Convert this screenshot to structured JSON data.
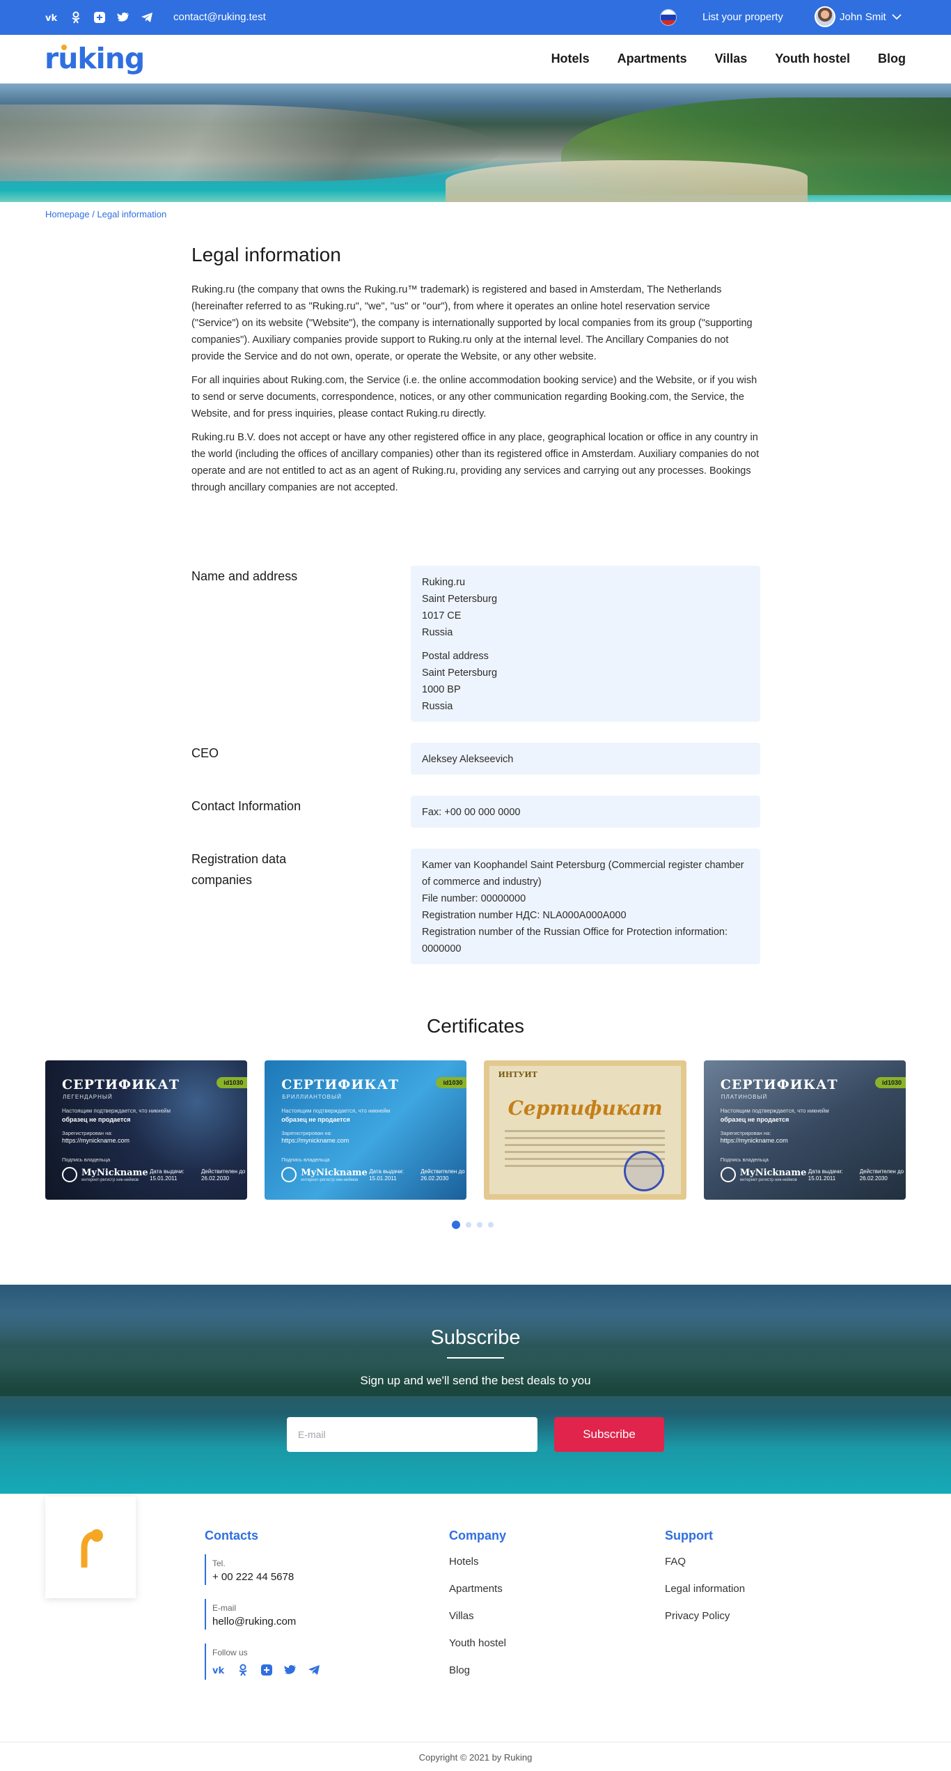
{
  "topbar": {
    "social_icons": [
      "vk-icon",
      "odnoklassniki-icon",
      "plus-icon",
      "twitter-icon",
      "telegram-icon"
    ],
    "email": "contact@ruking.test",
    "language_flag": "russia-flag",
    "list_property": "List your property",
    "user_name": "John Smit"
  },
  "header": {
    "logo_text": "ruking",
    "nav": [
      "Hotels",
      "Apartments",
      "Villas",
      "Youth hostel",
      "Blog"
    ]
  },
  "breadcrumb": {
    "home": "Homepage",
    "separator": " / ",
    "current": "Legal information"
  },
  "page": {
    "title": "Legal information",
    "paragraphs": [
      "Ruking.ru (the company that owns the Ruking.ru™ trademark) is registered and based in Amsterdam, The Netherlands (hereinafter referred to as \"Ruking.ru\", \"we\", \"us\" or \"our\"), from where it operates an online hotel reservation service (\"Service\") on its website (\"Website\"), the company is internationally supported by local companies from its group (\"supporting companies\"). Auxiliary companies provide support to Ruking.ru only at the internal level. The Ancillary Companies do not provide the Service and do not own, operate, or operate the Website, or any other website.",
      "For all inquiries about Ruking.com, the Service (i.e. the online accommodation booking service) and the Website, or if you wish to send or serve documents, correspondence, notices, or any other communication regarding Booking.com, the Service, the Website, and for press inquiries, please contact Ruking.ru directly.",
      "Ruking.ru B.V. does not accept or have any other registered office in any place, geographical location or office in any country in the world (including the offices of ancillary companies) other than its registered office in Amsterdam. Auxiliary companies do not operate and are not entitled to act as an agent of Ruking.ru, providing any services and carrying out any processes. Bookings through ancillary companies are not accepted."
    ]
  },
  "info": {
    "name_address": {
      "label": "Name and address",
      "lines_a": [
        "Ruking.ru",
        "Saint Petersburg",
        "1017 CE",
        "Russia"
      ],
      "lines_b": [
        "Postal address",
        "Saint Petersburg",
        "1000 BP",
        "Russia"
      ]
    },
    "ceo": {
      "label": "CEO",
      "value": "Aleksey Alekseevich"
    },
    "contact": {
      "label": "Contact Information",
      "value": "Fax: +00 00 000 0000"
    },
    "registration": {
      "label": "Registration data companies",
      "lines": [
        "Kamer van Koophandel  Saint Petersburg (Commercial register chamber of commerce and industry)",
        "File number: 00000000",
        "Registration number НДС: NLA000A000A000",
        "Registration number of the Russian Office for Protection information: 0000000"
      ]
    }
  },
  "certificates": {
    "title": "Certificates",
    "items": [
      {
        "title": "СЕРТИФИКАТ",
        "subtitle": "ЛЕГЕНДАРНЫЙ",
        "id": "id1030",
        "confirm": "Настоящим подтверждается, что никнейм",
        "not_for_sale": "образец не продается",
        "registered": "Зарегистрирован на:",
        "url": "https://mynickname.com",
        "signature": "Подпись владельца",
        "brand": "MyNickname",
        "brand_sub": "интернет-регистр ник-неймов",
        "issued_label": "Дата выдачи:",
        "issued": "15.01.2011",
        "valid_label": "Действителен до",
        "valid": "26.02.2030"
      },
      {
        "title": "СЕРТИФИКАТ",
        "subtitle": "БРИЛЛИАНТОВЫЙ",
        "id": "id1030",
        "confirm": "Настоящим подтверждается, что никнейм",
        "not_for_sale": "образец не продается",
        "registered": "Зарегистрирован на:",
        "url": "https://mynickname.com",
        "signature": "Подпись владельца",
        "brand": "MyNickname",
        "brand_sub": "интернет-регистр ник-неймов",
        "issued_label": "Дата выдачи:",
        "issued": "15.01.2011",
        "valid_label": "Действителен до",
        "valid": "26.02.2030"
      },
      {
        "header": "ИНТУИТ",
        "title": "Сертификат"
      },
      {
        "title": "СЕРТИФИКАТ",
        "subtitle": "ПЛАТИНОВЫЙ",
        "id": "id1030",
        "confirm": "Настоящим подтверждается, что никнейм",
        "not_for_sale": "образец не продается",
        "registered": "Зарегистрирован на:",
        "url": "https://mynickname.com",
        "signature": "Подпись владельца",
        "brand": "MyNickname",
        "brand_sub": "интернет-регистр ник-неймов",
        "issued_label": "Дата выдачи:",
        "issued": "15.01.2011",
        "valid_label": "Действителен до",
        "valid": "26.02.2030"
      }
    ],
    "pagination": {
      "total": 4,
      "active_index": 0
    }
  },
  "subscribe": {
    "title": "Subscribe",
    "text": "Sign up and we'll send the best deals to you",
    "email_placeholder": "E-mail",
    "button": "Subscribe"
  },
  "footer": {
    "contacts": {
      "title": "Contacts",
      "tel_label": "Tel.",
      "tel": "+ 00 222 44 5678",
      "email_label": "E-mail",
      "email": "hello@ruking.com",
      "follow_label": "Follow us"
    },
    "company": {
      "title": "Company",
      "links": [
        "Hotels",
        "Apartments",
        "Villas",
        "Youth hostel",
        "Blog"
      ]
    },
    "support": {
      "title": "Support",
      "links": [
        "FAQ",
        "Legal information",
        "Privacy Policy"
      ]
    },
    "copyright": "Copyright © 2021 by Ruking"
  },
  "colors": {
    "primary": "#2f6fe0",
    "accent": "#e0244b",
    "logo_accent": "#f5a623",
    "info_box_bg": "#eef4fd"
  }
}
